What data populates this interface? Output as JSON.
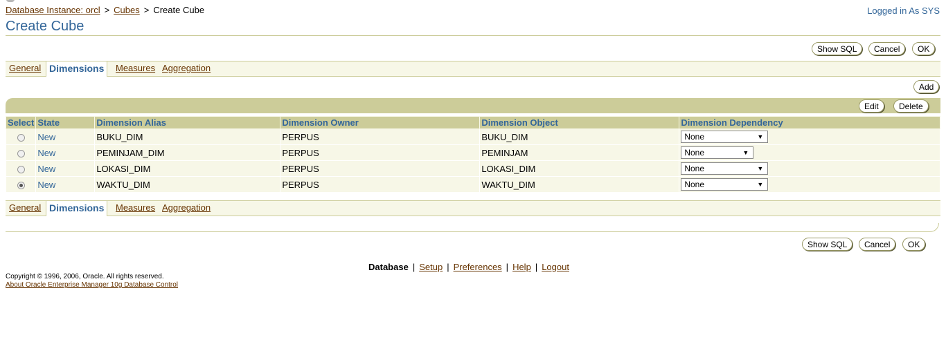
{
  "breadcrumb": {
    "items": [
      {
        "label": "Database Instance: orcl"
      },
      {
        "label": "Cubes"
      }
    ],
    "separator": ">",
    "current": "Create Cube"
  },
  "header": {
    "logged_in": "Logged in As SYS",
    "title": "Create Cube"
  },
  "actions": {
    "show_sql": "Show SQL",
    "cancel": "Cancel",
    "ok": "OK"
  },
  "tabs": {
    "general": "General",
    "dimensions": "Dimensions",
    "measures": "Measures",
    "aggregation": "Aggregation",
    "active": "Dimensions"
  },
  "table_actions": {
    "add": "Add",
    "edit": "Edit",
    "delete": "Delete"
  },
  "table": {
    "headers": [
      "Select",
      "State",
      "Dimension Alias",
      "Dimension Owner",
      "Dimension Object",
      "Dimension Dependency"
    ],
    "rows": [
      {
        "selected": false,
        "state": "New",
        "alias": "BUKU_DIM",
        "owner": "PERPUS",
        "object": "BUKU_DIM",
        "dependency": "None"
      },
      {
        "selected": false,
        "state": "New",
        "alias": "PEMINJAM_DIM",
        "owner": "PERPUS",
        "object": "PEMINJAM",
        "dependency": "None"
      },
      {
        "selected": false,
        "state": "New",
        "alias": "LOKASI_DIM",
        "owner": "PERPUS",
        "object": "LOKASI_DIM",
        "dependency": "None"
      },
      {
        "selected": true,
        "state": "New",
        "alias": "WAKTU_DIM",
        "owner": "PERPUS",
        "object": "WAKTU_DIM",
        "dependency": "None"
      }
    ]
  },
  "footer": {
    "current": "Database",
    "links": [
      "Setup",
      "Preferences",
      "Help",
      "Logout"
    ],
    "separator": "|",
    "copyright": "Copyright © 1996, 2006, Oracle. All rights reserved.",
    "about": "About Oracle Enterprise Manager 10g Database Control"
  },
  "colors": {
    "brand_blue": "#336699",
    "link_brown": "#663300",
    "khaki": "#cccc99",
    "row_bg": "#f7f7e7"
  }
}
